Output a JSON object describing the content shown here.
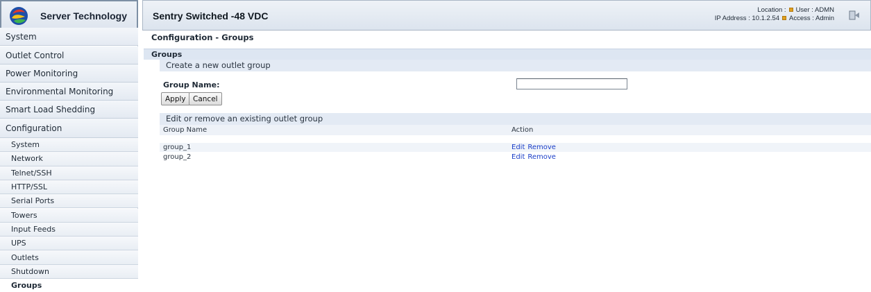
{
  "brand": {
    "name": "Server Technology",
    "logo_icon": "server-technology-logo"
  },
  "header": {
    "title": "Sentry Switched -48 VDC",
    "location_label": "Location :",
    "user_label": "User : ADMN",
    "ip_label": "IP Address : 10.1.2.54",
    "access_label": "Access : Admin",
    "logout_icon": "logout-icon"
  },
  "sidebar": {
    "main_items": [
      {
        "label": "System"
      },
      {
        "label": "Outlet Control"
      },
      {
        "label": "Power Monitoring"
      },
      {
        "label": "Environmental Monitoring"
      },
      {
        "label": "Smart Load Shedding"
      },
      {
        "label": "Configuration"
      }
    ],
    "config_items": [
      {
        "label": "System"
      },
      {
        "label": "Network"
      },
      {
        "label": "Telnet/SSH"
      },
      {
        "label": "HTTP/SSL"
      },
      {
        "label": "Serial Ports"
      },
      {
        "label": "Towers"
      },
      {
        "label": "Input Feeds"
      },
      {
        "label": "UPS"
      },
      {
        "label": "Outlets"
      },
      {
        "label": "Shutdown"
      },
      {
        "label": "Groups"
      }
    ],
    "active_item": "Groups"
  },
  "main": {
    "page_title": "Configuration - Groups",
    "section_title": "Groups",
    "create_title": "Create a new outlet group",
    "group_name_label": "Group Name:",
    "group_name_value": "",
    "apply_label": "Apply",
    "cancel_label": "Cancel",
    "edit_title": "Edit or remove an existing outlet group",
    "table": {
      "columns": [
        "Group Name",
        "Action"
      ],
      "rows": [
        {
          "name": "group_1",
          "edit": "Edit",
          "remove": "Remove"
        },
        {
          "name": "group_2",
          "edit": "Edit",
          "remove": "Remove"
        }
      ]
    }
  },
  "colors": {
    "link": "#1a3ec8",
    "section_bar": "#dde6f2",
    "status_dot": "#e0a020"
  }
}
